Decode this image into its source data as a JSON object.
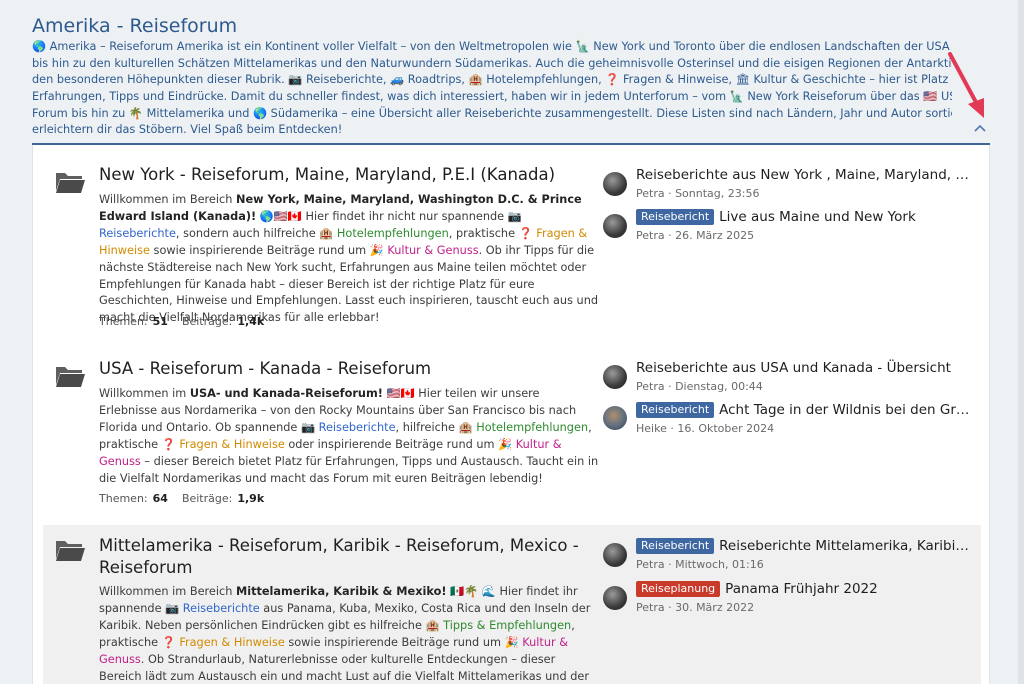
{
  "category": {
    "title": "Amerika - Reiseforum",
    "desc_lines": [
      "🌎 Amerika – Reiseforum Amerika ist ein Kontinent voller Vielfalt – von den Weltmetropolen wie 🗽 New York und Toronto über die endlosen Landschaften der USA und Kanada",
      "bis hin zu den kulturellen Schätzen Mittelamerikas und den Naturwundern Südamerikas. Auch die geheimnisvolle Osterinsel und die eisigen Regionen der Antarktis gehören zu",
      "den besonderen Höhepunkten dieser Rubrik. 📷 Reiseberichte, 🚙 Roadtrips, 🏨 Hotelempfehlungen, ❓ Fragen & Hinweise, 🏛 Kultur & Geschichte – hier ist Platz für eure",
      "Erfahrungen, Tipps und Eindrücke. Damit du schneller findest, was dich interessiert, haben wir in jedem Unterforum – vom 🗽 New York Reiseforum über das 🇺🇸 USA & Kanada",
      "Forum bis hin zu 🌴 Mittelamerika und 🌎 Südamerika – eine Übersicht aller Reiseberichte zusammengestellt. Diese Listen sind nach Ländern, Jahr und Autor sortiert und",
      "erleichtern dir das Stöbern. Viel Spaß beim Entdecken!"
    ],
    "collapse_icon": "chevron-up-icon",
    "accent_color": "#2d5a8e"
  },
  "labels": {
    "themen": "Themen:",
    "beitraege": "Beiträge:"
  },
  "forums": [
    {
      "title_lines": [
        "New York - Reiseforum, Maine, Maryland, P.E.I (Kanada)"
      ],
      "desc": {
        "t1": "Willkommen im Bereich ",
        "b1": "New York, Maine, Maryland, Washington D.C. & Prince Edward Island (Kanada)!",
        "t2": " 🌎🇺🇸🇨🇦 Hier findet ihr nicht nur spannende 📷 ",
        "l1": "Reiseberichte",
        "t3": ", sondern auch hilfreiche 🏨 ",
        "l2": "Hotelempfehlungen",
        "t4": ", praktische ❓ ",
        "l3": "Fragen & Hinweise",
        "t5": " sowie inspirierende Beiträge rund um 🎉 ",
        "l4": "Kultur & Genuss",
        "t6": ". Ob ihr Tipps für die nächste Städtereise nach New York sucht, Erfahrungen aus Maine teilen möchtet oder Empfehlungen für Kanada habt – dieser Bereich ist der richtige Platz für eure Geschichten, Hinweise und Empfehlungen. Lasst euch inspirieren, tauscht euch aus und macht die Vielfalt Nordamerikas für alle erlebbar!"
      },
      "themen": "51",
      "beitraege": "1,4k",
      "latest": [
        {
          "badge": "",
          "title": "Reiseberichte aus New York , Maine, Maryland, P.E.I (Kanada) – Übersicht",
          "meta": "Petra · Sonntag, 23:56"
        },
        {
          "badge": "Reisebericht",
          "title": "Live aus Maine und New York",
          "meta": "Petra · 26. März 2025"
        }
      ]
    },
    {
      "title_lines": [
        "USA - Reiseforum - Kanada - Reiseforum"
      ],
      "desc": {
        "t1": "Willkommen im ",
        "b1": "USA- und Kanada-Reiseforum!",
        "t2": " 🇺🇸🇨🇦 Hier teilen wir unsere Erlebnisse aus Nordamerika – von den Rocky Mountains über San Francisco bis nach Florida und Ontario. Ob spannende 📷 ",
        "l1": "Reiseberichte",
        "t3": ", hilfreiche 🏨 ",
        "l2": "Hotelempfehlungen",
        "t4": ", praktische ❓ ",
        "l3": "Fragen & Hinweise",
        "t5": " oder inspirierende Beiträge rund um 🎉 ",
        "l4": "Kultur & Genuss",
        "t6": " – dieser Bereich bietet Platz für Erfahrungen, Tipps und Austausch. Taucht ein in die Vielfalt Nordamerikas und macht das Forum mit euren Beiträgen lebendig!"
      },
      "themen": "64",
      "beitraege": "1,9k",
      "latest": [
        {
          "badge": "",
          "title": "Reiseberichte aus USA und Kanada - Übersicht",
          "meta": "Petra · Dienstag, 00:44"
        },
        {
          "badge": "Reisebericht",
          "title": "Acht Tage in der Wildnis bei den Grizzlys",
          "meta": "Heike · 16. Oktober 2024"
        }
      ]
    },
    {
      "title_lines": [
        "Mittelamerika - Reiseforum, Karibik - Reiseforum, Mexico -",
        "Reiseforum"
      ],
      "desc": {
        "t1": "Willkommen im Bereich ",
        "b1": "Mittelamerika, Karibik & Mexiko!",
        "t2": " 🇲🇽🌴 🌊 Hier findet ihr spannende 📷 ",
        "l1": "Reiseberichte",
        "t3": " aus Panama, Kuba, Mexiko, Costa Rica und den Inseln der Karibik. Neben persönlichen Eindrücken gibt es hilfreiche 🏨 ",
        "l2": "Tipps & Empfehlungen",
        "t4": ", praktische ❓ ",
        "l3": "Fragen & Hinweise",
        "t5": " sowie inspirierende Beiträge rund um 🎉 ",
        "l4": "Kultur & Genuss",
        "t6": ". Ob Strandurlaub, Naturerlebnisse oder kulturelle Entdeckungen – dieser Bereich lädt zum Austausch ein und macht Lust auf die Vielfalt Mittelamerikas und der Karibik."
      },
      "themen": "",
      "beitraege": "",
      "latest": [
        {
          "badge": "Reisebericht",
          "title": "Reiseberichte Mittelamerika, Karibik, Mexico - Übersicht",
          "meta": "Petra · Mittwoch, 01:16"
        },
        {
          "badge": "Reiseplanung",
          "title": "Panama Frühjahr 2022",
          "meta": "Petra · 30. März 2022"
        }
      ]
    }
  ]
}
